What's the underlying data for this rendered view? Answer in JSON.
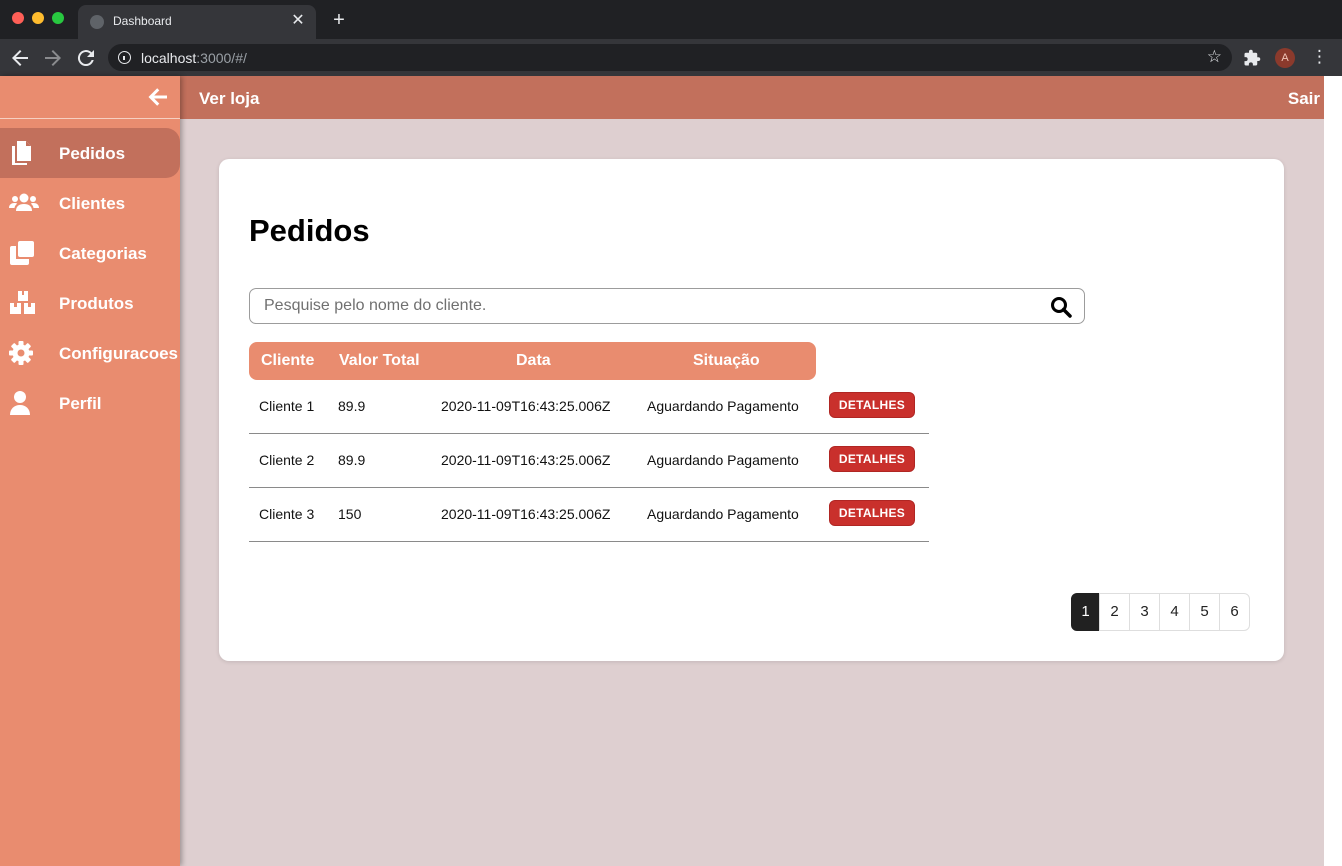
{
  "browser": {
    "tab_title": "Dashboard",
    "url_host": "localhost",
    "url_rest": ":3000/#/",
    "profile_initial": "A"
  },
  "topbar": {
    "store_link": "Ver loja",
    "logout": "Sair"
  },
  "sidebar": {
    "items": [
      {
        "label": "Pedidos",
        "icon": "copy-icon",
        "active": true
      },
      {
        "label": "Clientes",
        "icon": "users-icon",
        "active": false
      },
      {
        "label": "Categorias",
        "icon": "clone-icon",
        "active": false
      },
      {
        "label": "Produtos",
        "icon": "boxes-icon",
        "active": false
      },
      {
        "label": "Configuracoes",
        "icon": "cog-icon",
        "active": false
      },
      {
        "label": "Perfil",
        "icon": "user-icon",
        "active": false
      }
    ]
  },
  "main": {
    "title": "Pedidos",
    "search_placeholder": "Pesquise pelo nome do cliente.",
    "columns": [
      "Cliente",
      "Valor Total",
      "Data",
      "Situação"
    ],
    "rows": [
      {
        "cliente": "Cliente 1",
        "valor": "89.9",
        "data": "2020-11-09T16:43:25.006Z",
        "situacao": "Aguardando Pagamento",
        "action": "DETALHES"
      },
      {
        "cliente": "Cliente 2",
        "valor": "89.9",
        "data": "2020-11-09T16:43:25.006Z",
        "situacao": "Aguardando Pagamento",
        "action": "DETALHES"
      },
      {
        "cliente": "Cliente 3",
        "valor": "150",
        "data": "2020-11-09T16:43:25.006Z",
        "situacao": "Aguardando Pagamento",
        "action": "DETALHES"
      }
    ],
    "pagination": {
      "pages": [
        "1",
        "2",
        "3",
        "4",
        "5",
        "6"
      ],
      "current": "1"
    }
  },
  "colors": {
    "sidebar": "#e98c6f",
    "sidebar_active": "#c2705c",
    "topbar": "#c2705c",
    "background": "#decfd0",
    "detail_button": "#c9302c"
  }
}
